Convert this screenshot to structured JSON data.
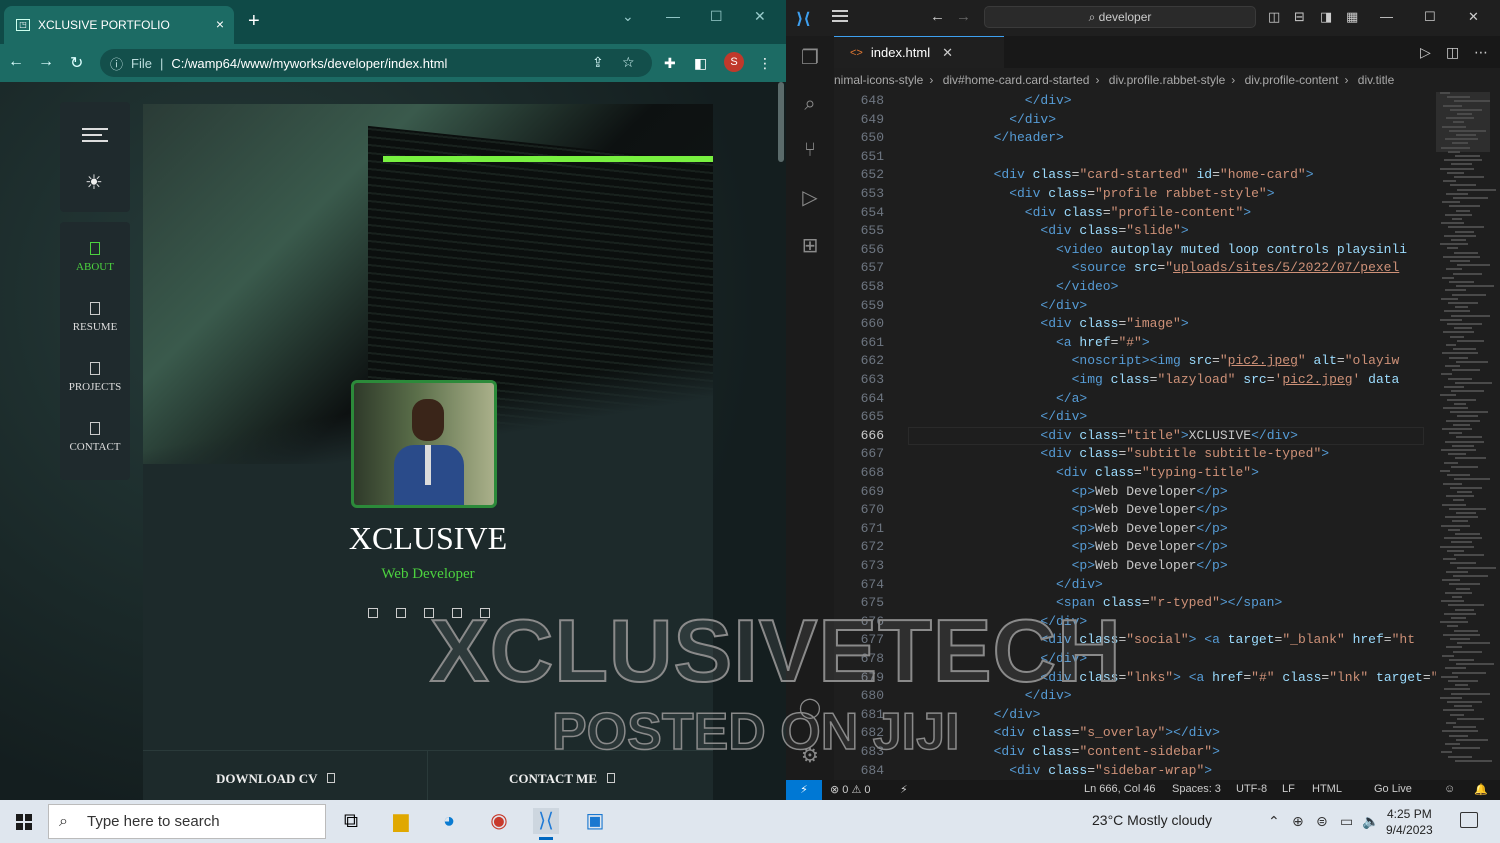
{
  "browser": {
    "tab_title": "XCLUSIVE PORTFOLIO",
    "tab_close": "×",
    "new_tab": "+",
    "window_controls": [
      "⌄",
      "—",
      "☐",
      "✕"
    ],
    "address": {
      "scheme": "File",
      "url": "C:/wamp64/www/myworks/developer/index.html"
    },
    "profile_initial": "S"
  },
  "site": {
    "sidebar_nav": [
      {
        "label": "ABOUT",
        "active": true
      },
      {
        "label": "RESUME",
        "active": false
      },
      {
        "label": "PROJECTS",
        "active": false
      },
      {
        "label": "CONTACT",
        "active": false
      }
    ],
    "name": "XCLUSIVE",
    "role": "Web Developer",
    "footer_buttons": [
      "DOWNLOAD CV",
      "CONTACT ME"
    ],
    "colors": {
      "accent": "#4cd23f",
      "card": "#1d2a2b"
    }
  },
  "vscode": {
    "search_text": "developer",
    "tab_file": "index.html",
    "breadcrumbs": [
      "nimal-icons-style",
      "div#home-card.card-started",
      "div.profile.rabbet-style",
      "div.profile-content",
      "div.title"
    ],
    "current_line": 666,
    "code_lines": [
      {
        "n": 648,
        "indent": 16,
        "html": "<span class='tag'>&lt;/div&gt;</span>"
      },
      {
        "n": 649,
        "indent": 14,
        "html": "<span class='tag'>&lt;/div&gt;</span>"
      },
      {
        "n": 650,
        "indent": 12,
        "html": "<span class='tag'>&lt;/header&gt;</span>"
      },
      {
        "n": 651,
        "indent": 0,
        "html": ""
      },
      {
        "n": 652,
        "indent": 12,
        "html": "<span class='tag'>&lt;div</span> <span class='attr'>class</span>=<span class='str'>\"card-started\"</span> <span class='attr'>id</span>=<span class='str'>\"home-card\"</span><span class='tag'>&gt;</span>"
      },
      {
        "n": 653,
        "indent": 14,
        "html": "<span class='tag'>&lt;div</span> <span class='attr'>class</span>=<span class='str'>\"profile rabbet-style\"</span><span class='tag'>&gt;</span>"
      },
      {
        "n": 654,
        "indent": 16,
        "html": "<span class='tag'>&lt;div</span> <span class='attr'>class</span>=<span class='str'>\"profile-content\"</span><span class='tag'>&gt;</span>"
      },
      {
        "n": 655,
        "indent": 18,
        "html": "<span class='tag'>&lt;div</span> <span class='attr'>class</span>=<span class='str'>\"slide\"</span><span class='tag'>&gt;</span>"
      },
      {
        "n": 656,
        "indent": 20,
        "html": "<span class='tag'>&lt;video</span> <span class='attr'>autoplay muted loop controls playsinli</span>"
      },
      {
        "n": 657,
        "indent": 22,
        "html": "<span class='tag'>&lt;source</span> <span class='attr'>src</span>=<span class='str'>\"<u>uploads/sites/5/2022/07/pexel</u></span>"
      },
      {
        "n": 658,
        "indent": 20,
        "html": "<span class='tag'>&lt;/video&gt;</span>"
      },
      {
        "n": 659,
        "indent": 18,
        "html": "<span class='tag'>&lt;/div&gt;</span>"
      },
      {
        "n": 660,
        "indent": 18,
        "html": "<span class='tag'>&lt;div</span> <span class='attr'>class</span>=<span class='str'>\"image\"</span><span class='tag'>&gt;</span>"
      },
      {
        "n": 661,
        "indent": 20,
        "html": "<span class='tag'>&lt;a</span> <span class='attr'>href</span>=<span class='str'>\"#\"</span><span class='tag'>&gt;</span>"
      },
      {
        "n": 662,
        "indent": 22,
        "html": "<span class='tag'>&lt;noscript&gt;&lt;img</span> <span class='attr'>src</span>=<span class='str'>\"<u>pic2.jpeg</u>\"</span> <span class='attr'>alt</span>=<span class='str'>\"olayiw</span>"
      },
      {
        "n": 663,
        "indent": 22,
        "html": "<span class='tag'>&lt;img</span> <span class='attr'>class</span>=<span class='str'>\"lazyload\"</span> <span class='attr'>src</span>=<span class='str'>'<u>pic2.jpeg</u>'</span> <span class='attr'>data</span>"
      },
      {
        "n": 664,
        "indent": 20,
        "html": "<span class='tag'>&lt;/a&gt;</span>"
      },
      {
        "n": 665,
        "indent": 18,
        "html": "<span class='tag'>&lt;/div&gt;</span>"
      },
      {
        "n": 666,
        "indent": 18,
        "html": "<span class='tag'>&lt;div</span> <span class='attr'>class</span>=<span class='str'>\"title\"</span><span class='tag'>&gt;</span>XCLUSIVE<span class='tag'>&lt;/div&gt;</span>"
      },
      {
        "n": 667,
        "indent": 18,
        "html": "<span class='tag'>&lt;div</span> <span class='attr'>class</span>=<span class='str'>\"subtitle subtitle-typed\"</span><span class='tag'>&gt;</span>"
      },
      {
        "n": 668,
        "indent": 20,
        "html": "<span class='tag'>&lt;div</span> <span class='attr'>class</span>=<span class='str'>\"typing-title\"</span><span class='tag'>&gt;</span>"
      },
      {
        "n": 669,
        "indent": 22,
        "html": "<span class='tag'>&lt;p&gt;</span>Web Developer<span class='tag'>&lt;/p&gt;</span>"
      },
      {
        "n": 670,
        "indent": 22,
        "html": "<span class='tag'>&lt;p&gt;</span>Web Developer<span class='tag'>&lt;/p&gt;</span>"
      },
      {
        "n": 671,
        "indent": 22,
        "html": "<span class='tag'>&lt;p&gt;</span>Web Developer<span class='tag'>&lt;/p&gt;</span>"
      },
      {
        "n": 672,
        "indent": 22,
        "html": "<span class='tag'>&lt;p&gt;</span>Web Developer<span class='tag'>&lt;/p&gt;</span>"
      },
      {
        "n": 673,
        "indent": 22,
        "html": "<span class='tag'>&lt;p&gt;</span>Web Developer<span class='tag'>&lt;/p&gt;</span>"
      },
      {
        "n": 674,
        "indent": 20,
        "html": "<span class='tag'>&lt;/div&gt;</span>"
      },
      {
        "n": 675,
        "indent": 20,
        "html": "<span class='tag'>&lt;span</span> <span class='attr'>class</span>=<span class='str'>\"r-typed\"</span><span class='tag'>&gt;&lt;/span&gt;</span>"
      },
      {
        "n": 676,
        "indent": 18,
        "html": "<span class='tag'>&lt;/div&gt;</span>"
      },
      {
        "n": 677,
        "indent": 18,
        "html": "<span class='tag'>&lt;div</span> <span class='attr'>class</span>=<span class='str'>\"social\"</span><span class='tag'>&gt;</span> <span class='tag'>&lt;a</span> <span class='attr'>target</span>=<span class='str'>\"_blank\"</span> <span class='attr'>href</span>=<span class='str'>\"ht</span>"
      },
      {
        "n": 678,
        "indent": 18,
        "html": "<span class='tag'>&lt;/div&gt;</span>"
      },
      {
        "n": 679,
        "indent": 18,
        "html": "<span class='tag'>&lt;div</span> <span class='attr'>class</span>=<span class='str'>\"lnks\"</span><span class='tag'>&gt;</span> <span class='tag'>&lt;a</span> <span class='attr'>href</span>=<span class='str'>\"#\"</span> <span class='attr'>class</span>=<span class='str'>\"lnk\"</span> <span class='attr'>target</span>=<span class='str'>\"</span>"
      },
      {
        "n": 680,
        "indent": 16,
        "html": "<span class='tag'>&lt;/div&gt;</span>"
      },
      {
        "n": 681,
        "indent": 12,
        "html": "<span class='tag'>&lt;/div&gt;</span>"
      },
      {
        "n": 682,
        "indent": 12,
        "html": "<span class='tag'>&lt;div</span> <span class='attr'>class</span>=<span class='str'>\"s_overlay\"</span><span class='tag'>&gt;&lt;/div&gt;</span>"
      },
      {
        "n": 683,
        "indent": 12,
        "html": "<span class='tag'>&lt;div</span> <span class='attr'>class</span>=<span class='str'>\"content-sidebar\"</span><span class='tag'>&gt;</span>"
      },
      {
        "n": 684,
        "indent": 14,
        "html": "<span class='tag'>&lt;div</span> <span class='attr'>class</span>=<span class='str'>\"sidebar-wrap\"</span><span class='tag'>&gt;</span>"
      }
    ],
    "status": {
      "problems": "⊗ 0 ⚠ 0",
      "cursor": "Ln 666, Col 46",
      "spaces": "Spaces: 3",
      "encoding": "UTF-8",
      "eol": "LF",
      "language": "HTML",
      "golive": "Go Live"
    }
  },
  "taskbar": {
    "search_placeholder": "Type here to search",
    "weather": "23°C  Mostly cloudy",
    "time": "4:25 PM",
    "date": "9/4/2023"
  },
  "watermark": {
    "line1": "XCLUSIVETECH",
    "line2": "POSTED ON JIJI"
  }
}
